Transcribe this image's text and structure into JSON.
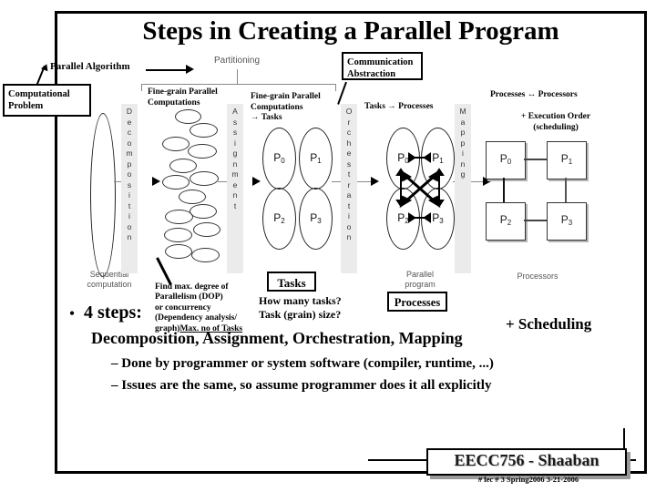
{
  "slide": {
    "title": "Steps in Creating a Parallel Program"
  },
  "callouts": {
    "computational_problem": "Computational\nProblem",
    "parallel_algorithm": "Parallel Algorithm",
    "communication_abstraction": "Communication\nAbstraction",
    "partitioning": "Partitioning"
  },
  "stages": [
    {
      "id": "decomposition",
      "label": "Decomposition",
      "letters": [
        "D",
        "e",
        "c",
        "o",
        "m",
        "p",
        "o",
        "s",
        "i",
        "t",
        "i",
        "o",
        "n"
      ]
    },
    {
      "id": "assignment",
      "label": "Assignment",
      "letters": [
        "A",
        "s",
        "s",
        "i",
        "g",
        "n",
        "m",
        "e",
        "n",
        "t"
      ]
    },
    {
      "id": "orchestration",
      "label": "Orchestration",
      "letters": [
        "O",
        "r",
        "c",
        "h",
        "e",
        "s",
        "t",
        "r",
        "a",
        "t",
        "i",
        "o",
        "n"
      ]
    },
    {
      "id": "mapping",
      "label": "Mapping",
      "letters": [
        "M",
        "a",
        "p",
        "p",
        "i",
        "n",
        "g"
      ]
    }
  ],
  "stage_annotations": {
    "fine_grain_1": "Fine-grain Parallel\nComputations",
    "fine_grain_2": "Fine-grain Parallel\nComputations\n→ Tasks",
    "tasks_to_processes": "Tasks → Processes",
    "processes_to_processors": "Processes ↔ Processors",
    "execution_order": "+  Execution Order\n(scheduling)"
  },
  "figure_labels": {
    "sequential_computation": "Sequential\ncomputation",
    "parallel_program": "Parallel\nprogram",
    "processors": "Processors"
  },
  "notes": {
    "dop": "Find max. degree of\nParallelism (DOP)\nor concurrency\n(Dependency analysis/\ngraph)",
    "dop_underlined": "Max. no of Tasks",
    "tasks_box": "Tasks",
    "tasks_question": "How many tasks?\nTask (grain) size?",
    "processes_box": "Processes",
    "scheduling": "+ Scheduling"
  },
  "processes": [
    "P0",
    "P1",
    "P2",
    "P3"
  ],
  "processors": [
    "P0",
    "P1",
    "P2",
    "P3"
  ],
  "bullets": {
    "steps_dot": "•",
    "steps": "4 steps:",
    "steps_names": "Decomposition, Assignment, Orchestration, Mapping",
    "sub": [
      {
        "dash": "–",
        "text": "Done by programmer or system software (compiler, runtime, ...)"
      },
      {
        "dash": "–",
        "text": "Issues are the same, so assume programmer does it all explicitly"
      }
    ]
  },
  "footer": {
    "course": "EECC756 - Shaaban",
    "meta": "#  lec # 3   Spring2006  3-21-2006"
  },
  "colors": {
    "background": "#ffffff",
    "text": "#000000",
    "lane": "#ebebeb",
    "figure_label": "#555555",
    "footer_shadow": "#9a9a9a"
  }
}
